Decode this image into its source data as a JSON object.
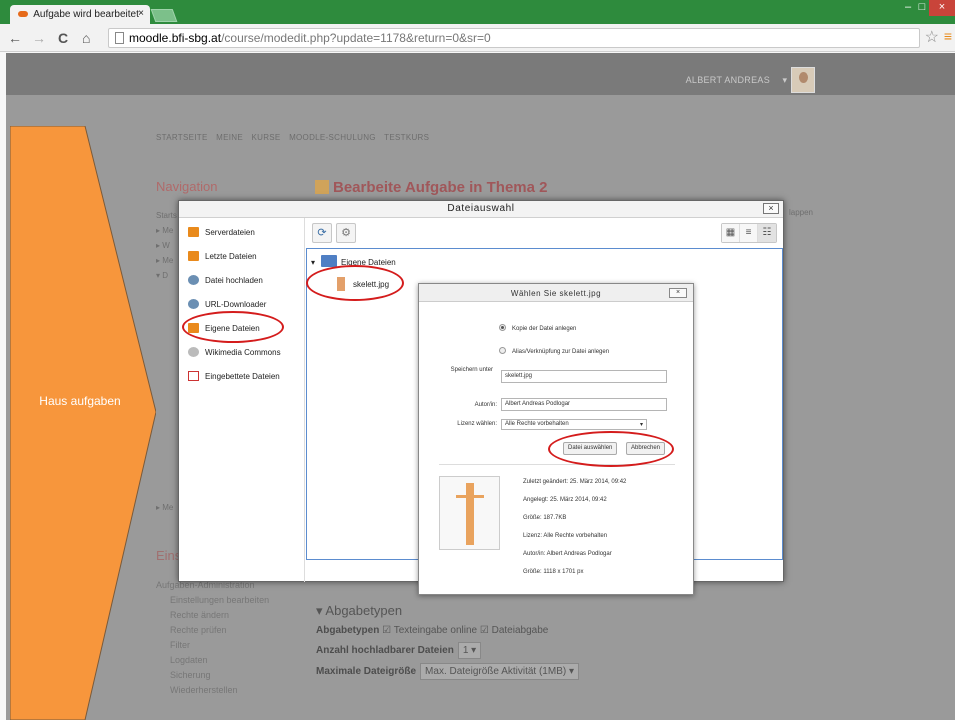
{
  "browser": {
    "tab_title": "Aufgabe wird bearbeitet",
    "tab_close": "×",
    "url_host": "moodle.bfi-sbg.at",
    "url_path": "/course/modedit.php?update=1178&return=0&sr=0",
    "back": "←",
    "forward": "→",
    "reload": "C",
    "home": "⌂",
    "star": "☆",
    "menu": "≡",
    "win_min": "–",
    "win_max": "□",
    "win_close": "×"
  },
  "moodle": {
    "user_name": "ALBERT ANDREAS",
    "user_caret": "▾",
    "breadcrumb": "STARTSEITE   MEINE KURSE   MOODLE-SCHULUNG   TESTKURS",
    "nav_title": "Navigation",
    "page_title": "Bearbeite Aufgabe in Thema 2",
    "bg_nav_lines": [
      "Starts",
      "▸ Me",
      "▸ W",
      "▸ Me",
      "▾ D"
    ],
    "bg_lappen": "lappen",
    "bg_me": "▸ Me",
    "bg_eins": "Eins",
    "bg_admin": {
      "title": "Aufgaben-Administration",
      "items": [
        "Einstellungen bearbeiten",
        "Rechte ändern",
        "Rechte prüfen",
        "Filter",
        "Logdaten",
        "Sicherung",
        "Wiederherstellen"
      ]
    },
    "section_title": "▾ Abgabetypen",
    "form": {
      "abgabetypen_label": "Abgabetypen",
      "abgabetypen_opt1": "Texteingabe online",
      "abgabetypen_opt2": "Dateiabgabe",
      "anzahl_label": "Anzahl hochladbarer Dateien",
      "anzahl_value": "1 ▾",
      "maximale_label": "Maximale Dateigröße",
      "maximale_value": "Max. Dateigröße Aktivität (1MB) ▾"
    }
  },
  "annotation": {
    "arrow_label": "Haus aufgaben",
    "arrow_color": "#f7963c",
    "oval_color": "#d41c1c"
  },
  "dialog": {
    "title": "Dateiauswahl",
    "close": "×",
    "repositories": [
      {
        "label": "Serverdateien",
        "icon": "repository-icon"
      },
      {
        "label": "Letzte Dateien",
        "icon": "repository-icon"
      },
      {
        "label": "Datei hochladen",
        "icon": "upload-icon"
      },
      {
        "label": "URL-Downloader",
        "icon": "globe-icon"
      },
      {
        "label": "Eigene Dateien",
        "icon": "repository-icon"
      },
      {
        "label": "Wikimedia Commons",
        "icon": "wikimedia-icon"
      },
      {
        "label": "Eingebettete Dateien",
        "icon": "pdf-icon"
      }
    ],
    "refresh_icon": "⟳",
    "settings_icon": "⚙",
    "view_icons": [
      "▦",
      "≡",
      "☷"
    ],
    "tree_root": "Eigene Dateien",
    "tree_caret": "▾",
    "tree_file": "skelett.jpg"
  },
  "select_file": {
    "title": "Wählen Sie skelett.jpg",
    "close": "×",
    "radio_copy": "Kopie der Datei anlegen",
    "radio_alias": "Alias/Verknüpfung zur Datei anlegen",
    "save_as_label": "Speichern unter",
    "save_as_value": "skelett.jpg",
    "author_label": "Autor/in:",
    "author_value": "Albert Andreas Podlogar",
    "license_label": "Lizenz wählen:",
    "license_value": "Alle Rechte vorbehalten",
    "license_caret": "▾",
    "select_button": "Datei auswählen",
    "cancel_button": "Abbrechen",
    "info": {
      "modified": "Zuletzt geändert: 25. März 2014, 09:42",
      "created": "Angelegt: 25. März 2014, 09:42",
      "size": "Größe: 187.7KB",
      "license": "Lizenz: Alle Rechte vorbehalten",
      "author": "Autor/in: Albert Andreas Podlogar",
      "dimensions": "Größe: 1118 x 1701 px"
    }
  }
}
